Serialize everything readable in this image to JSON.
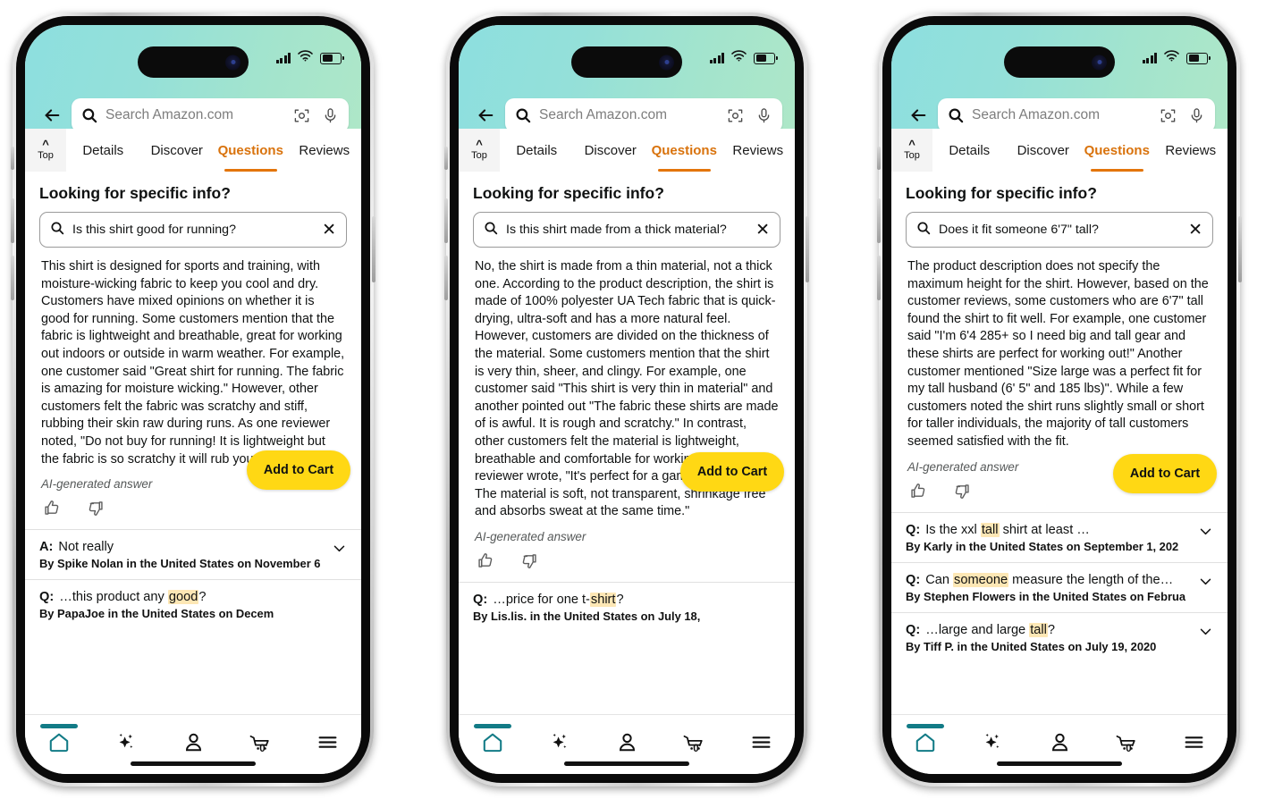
{
  "statusbar": {
    "signal_icon": "signal-bars-icon",
    "wifi_icon": "wifi-icon",
    "battery_icon": "battery-icon"
  },
  "search": {
    "placeholder": "Search Amazon.com",
    "back_icon": "back-arrow-icon",
    "camera_icon": "camera-lens-icon",
    "mic_icon": "microphone-icon"
  },
  "tabs": {
    "top_label": "Top",
    "items": [
      {
        "label": "Details",
        "active": false
      },
      {
        "label": "Discover",
        "active": false
      },
      {
        "label": "Questions",
        "active": true
      },
      {
        "label": "Reviews",
        "active": false
      }
    ]
  },
  "section": {
    "heading": "Looking for specific info?",
    "ai_note": "AI-generated answer",
    "thumbs_up_icon": "thumbs-up-icon",
    "thumbs_down_icon": "thumbs-down-icon",
    "clear_icon": "close-x-icon",
    "search_icon": "search-icon",
    "chevron_icon": "chevron-down-icon"
  },
  "add_to_cart": {
    "label": "Add to Cart",
    "color": "#ffd814"
  },
  "colors": {
    "accent_orange": "#e3750b",
    "nav_active_teal": "#127b86",
    "highlight_yellow": "#fde7b5",
    "header_gradient_start": "#8ddfdf",
    "header_gradient_end": "#aee7c8"
  },
  "bottom_nav": {
    "items": [
      {
        "icon": "home-icon",
        "active": true
      },
      {
        "icon": "ai-sparkle-icon",
        "active": false
      },
      {
        "icon": "account-person-icon",
        "active": false
      },
      {
        "icon": "shopping-cart-icon",
        "active": false,
        "count": "0"
      },
      {
        "icon": "hamburger-menu-icon",
        "active": false
      }
    ]
  },
  "phones": [
    {
      "query": "Is this shirt good for running?",
      "answer": "This shirt is designed for sports and training, with moisture-wicking fabric to keep you cool and dry. Customers have mixed opinions on whether it is good for running. Some customers mention that the fabric is lightweight and breathable, great for working out indoors or outside in warm weather. For example, one customer said \"Great shirt for running. The fabric is amazing for moisture wicking.\" However, other customers felt the fabric was scratchy and stiff, rubbing their skin raw during runs. As one reviewer noted, \"Do not buy for running! It is lightweight but the fabric is so scratchy it will rub your nipples raw.\"",
      "qa": [
        {
          "prefix": "A:",
          "text_before": "Not really",
          "highlight": "",
          "text_after": "",
          "byline": "By Spike Nolan in the United States on November 6",
          "has_chevron": true
        },
        {
          "prefix": "Q:",
          "text_before": "…this product any ",
          "highlight": "good",
          "text_after": "?",
          "byline": "By PapaJoe in the United States on Decem",
          "has_chevron": false
        }
      ]
    },
    {
      "query": "Is this shirt made from a thick material?",
      "answer": "No, the shirt is made from a thin material, not a thick one. According to the product description, the shirt is made of 100% polyester UA Tech fabric that is quick-drying, ultra-soft and has a more natural feel. However, customers are divided on the thickness of the material. Some customers mention that the shirt is very thin, sheer, and clingy. For example, one customer said \"This shirt is very thin in material\" and another pointed out \"The fabric these shirts are made of is awful. It is rough and scratchy.\" In contrast, other customers felt the material is lightweight, breathable and comfortable for working out. As one reviewer wrote, \"It's perfect for a game of pickleball. The material is soft, not transparent, shrinkage free and absorbs sweat at the same time.\"",
      "qa": [
        {
          "prefix": "Q:",
          "text_before": "…price for one t-",
          "highlight": "shirt",
          "text_after": "?",
          "byline": "By Lis.lis. in the United States on July 18,",
          "has_chevron": false
        }
      ]
    },
    {
      "query": "Does it fit someone 6'7\" tall?",
      "answer": "The product description does not specify the maximum height for the shirt. However, based on the customer reviews, some customers who are 6'7\" tall found the shirt to fit well. For example, one customer said \"I'm 6'4 285+ so I need big and tall gear and these shirts are perfect for working out!\" Another customer mentioned \"Size large was a perfect fit for my tall husband (6' 5\" and 185 lbs)\". While a few customers noted the shirt runs slightly small or short for taller individuals, the majority of tall customers seemed satisfied with the fit.",
      "qa": [
        {
          "prefix": "Q:",
          "text_before": "Is the xxl ",
          "highlight": "tall",
          "text_after": " shirt at least …",
          "byline": "By Karly in the United States on September 1, 202",
          "has_chevron": true
        },
        {
          "prefix": "Q:",
          "text_before": "Can ",
          "highlight": "someone",
          "text_after": " measure the length of the…",
          "byline": "By Stephen Flowers in the United States on Februa",
          "has_chevron": true
        },
        {
          "prefix": "Q:",
          "text_before": "…large and large ",
          "highlight": "tall",
          "text_after": "?",
          "byline": "By Tiff P. in the United States on July 19, 2020",
          "has_chevron": true
        }
      ]
    }
  ]
}
